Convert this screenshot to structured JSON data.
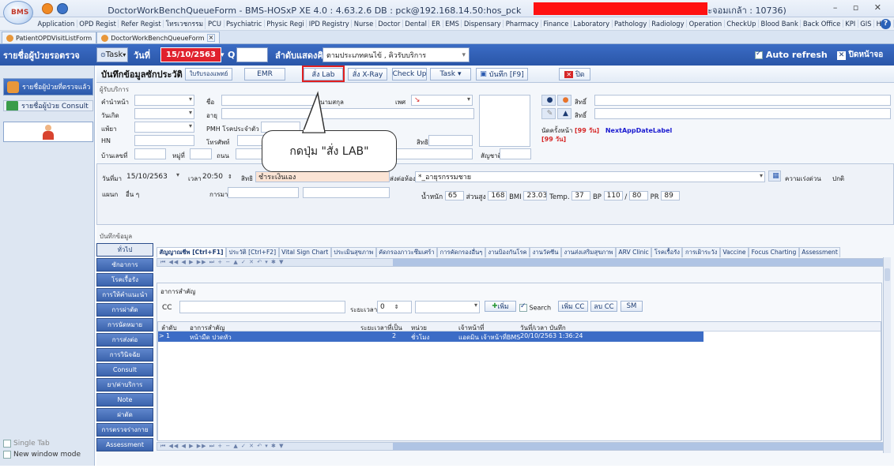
{
  "window": {
    "title": "DoctorWorkBenchQueueForm - BMS-HOSxP XE 4.0 : 4.63.2.6 DB : pck@192.168.14.50:hos_pck",
    "title_suffix": "ระจอมเกล้า : 10736)",
    "controls": "– ▫ ✕",
    "logo": "BMS"
  },
  "menu": [
    "Application",
    "OPD Regist",
    "Refer Regist",
    "โทรเวชกรรม",
    "PCU",
    "Psychiatric",
    "Physic Regi",
    "IPD Registry",
    "Nurse",
    "Doctor",
    "Dental",
    "ER",
    "EMS",
    "Dispensary",
    "Pharmacy",
    "Finance",
    "Laboratory",
    "Pathology",
    "Radiology",
    "Operation",
    "CheckUp",
    "Blood Bank",
    "Back Office",
    "KPI",
    "GIS",
    "HHC",
    "Tools"
  ],
  "doc_tabs": [
    {
      "label": "PatientOPDVisitListForm"
    },
    {
      "label": "DoctorWorkBenchQueueForm",
      "close": "×"
    }
  ],
  "queuebar": {
    "title": "รายชื่อผู้ป่วยรอตรวจ",
    "task_label": "Task",
    "day_label": "วันที่",
    "date": "15/10/2563",
    "q_label": "Q",
    "order_label": "ลำดับแสดงคิว",
    "order_value": "ตามประเภทคนไข้ , คิวรับบริการ",
    "auto_refresh": "Auto refresh",
    "close_label": "ปิดหน้าจอ"
  },
  "left": {
    "items": [
      "รายชื่อผู้ป่วยที่ตรวจแล้ว",
      "รายชื่อผู้ป่วย Consult"
    ],
    "single_tab": "Single Tab",
    "new_window": "New window mode"
  },
  "toolbar": {
    "header": "บันทึกข้อมูลซักประวัติ",
    "referral": "ใบรับรองแพทย์",
    "emr": "EMR",
    "lab": "สั่ง Lab",
    "xray": "สั่ง X-Ray",
    "checkup": "Check Up",
    "task": "Task",
    "save": "บันทึก [F9]",
    "close": "ปิด"
  },
  "patient": {
    "section": "ผู้รับบริการ",
    "prefix": "คำนำหน้า",
    "name": "ชื่อ",
    "lastname": "นามสกุล",
    "sex": "เพศ",
    "dob": "วันเกิด",
    "age": "อายุ",
    "nation": "สัญชาติ",
    "pmh": "PMH โรคประจำตัว",
    "tel": "โทรศัพท์",
    "hn": "HN",
    "house": "บ้านเลขที่",
    "moo": "หมู่ที่",
    "road": "ถนน",
    "allergy": "แพ้ยา",
    "right_rows": [
      "สิทธิ์",
      "สิทธิ์"
    ],
    "appt": "นัดครั้งหน้า",
    "appt_days": "[99 วัน]",
    "appt_days2": "[99 วัน]",
    "next_app": "NextAppDateLabel",
    "sub": "สิทธิ",
    "ethnicity": "สัญชาติ"
  },
  "visit": {
    "date_label": "วันที่มา",
    "date": "15/10/2563",
    "time_label": "เวลา",
    "time": "20:50",
    "right_label": "สิทธิ",
    "right_value": "ชำระเงินเอง",
    "send_label": "ส่งต่อห้อง",
    "send_value": "*_อายุรกรรมชาย",
    "urgency": "ความเร่งด่วน",
    "urgency_value": "ปกติ",
    "dept_label": "แผนก",
    "dept_value": "อื่น ๆ",
    "method_label": "การมา",
    "weight_label": "น้ำหนัก",
    "weight": "65",
    "height_label": "ส่วนสูง",
    "height": "168",
    "bmi_label": "BMI",
    "bmi": "23.03",
    "temp_label": "Temp.",
    "temp": "37",
    "bp_label": "BP",
    "bp_sys": "110",
    "bp_sep": "/",
    "bp_dia": "80",
    "pr_label": "PR",
    "pr": "89"
  },
  "callout": "กดปุ่ม \"สั่ง LAB\"",
  "record_section": "บันทึกข้อมูล",
  "vtabs": [
    "ทั่วไป",
    "ซักอาการ",
    "โรคเรื้อรัง",
    "การให้คำแนะนำ",
    "การผ่าตัด",
    "การนัดหมาย",
    "การส่งต่อ",
    "การวินิจฉัย",
    "Consult",
    "ยา/ค่าบริการ",
    "Note",
    "ผ่าตัด",
    "การตรวจร่างกาย",
    "Assessment"
  ],
  "htabs": [
    "สัญญาณชีพ [Ctrl+F1]",
    "ประวัติ [Ctrl+F2]",
    "Vital Sign Chart",
    "ประเมินสุขภาพ",
    "คัดกรองภาวะซึมเศร้า",
    "การคัดกรองอื่นๆ",
    "งานป้องกันโรค",
    "งานวัคซีน",
    "งานส่งเสริมสุขภาพ",
    "ARV Clinic",
    "โรคเรื้อรัง",
    "การเฝ้าระวัง",
    "Vaccine",
    "Focus Charting",
    "Assessment"
  ],
  "nav": "⏮ ◀◀ ◀ ▶ ▶▶ ⏭ + − ▲ ✓ ✕ ↶ ▾ ✱ ▼",
  "symptom": {
    "section": "อาการสำคัญ",
    "cc_label": "CC",
    "duration_label": "ระยะเวลา",
    "duration": "0",
    "add": "เพิ่ม",
    "search": "Search",
    "add_cc": "เพิ่ม CC",
    "del_cc": "ลบ CC",
    "sm": "SM"
  },
  "grid": {
    "headers": [
      "ลำดับ",
      "อาการสำคัญ",
      "ระยะเวลาที่เป็น",
      "หน่วย",
      "เจ้าหน้าที่",
      "วันที่/เวลา บันทึก"
    ],
    "rows": [
      [
        "1",
        "หน้ามืด ปวดหัว",
        "2",
        "ชั่วโมง",
        "แอดมิน เจ้าหน้าที่BMS",
        "20/10/2563 1:36:24"
      ]
    ]
  }
}
